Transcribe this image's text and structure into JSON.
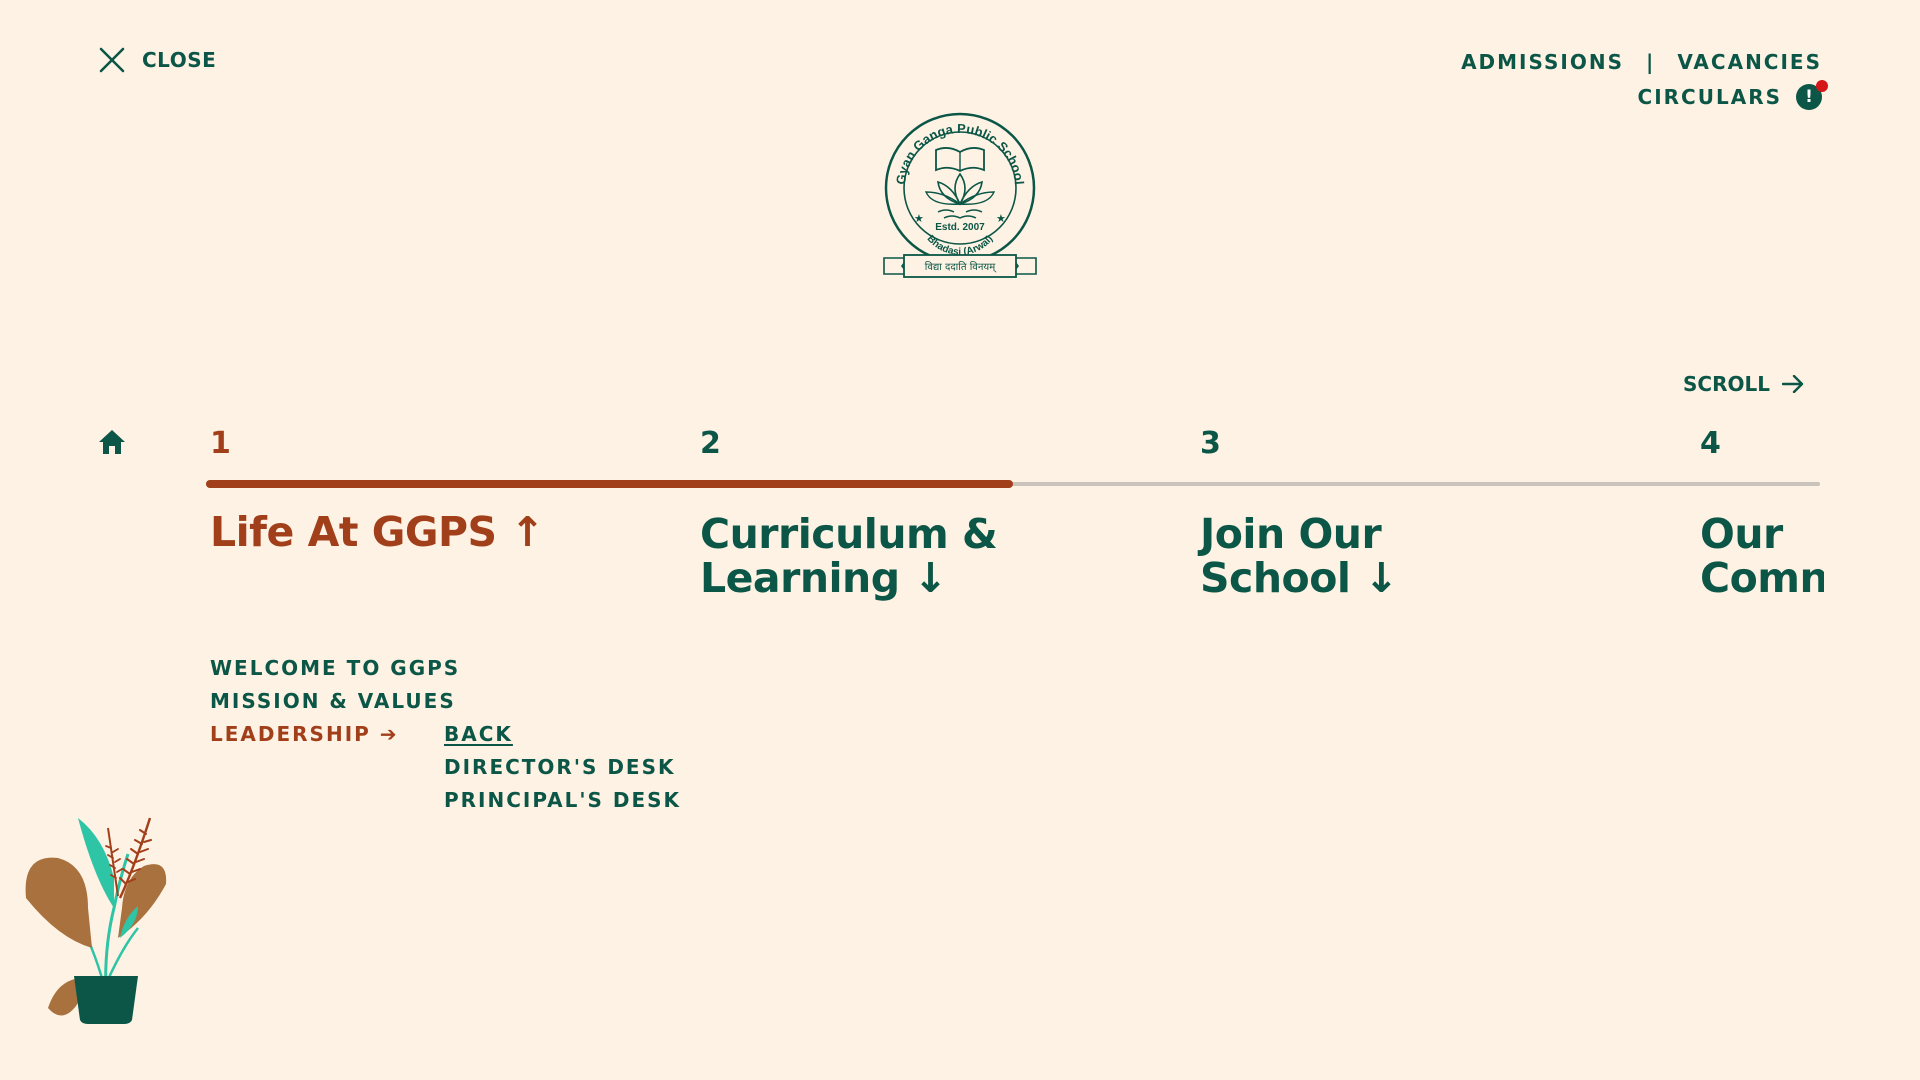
{
  "close": {
    "label": "CLOSE"
  },
  "top_links": {
    "admissions": "ADMISSIONS",
    "separator": "|",
    "vacancies": "VACANCIES",
    "circulars": "CIRCULARS",
    "circulars_alert": "!"
  },
  "logo": {
    "school_name": "Gyan Ganga Public School",
    "established": "Estd. 2007",
    "location": "Bhadasi (Arwal)",
    "motto": "विद्या ददाति विनयम्"
  },
  "scroll": {
    "label": "SCROLL"
  },
  "nav": {
    "progress": 0.5,
    "sections": [
      {
        "number": "1",
        "line1": "Life At GGPS",
        "line2": "",
        "arrow": "↑"
      },
      {
        "number": "2",
        "line1": "Curriculum &",
        "line2": "Learning",
        "arrow": "↓"
      },
      {
        "number": "3",
        "line1": "Join Our",
        "line2": "School",
        "arrow": "↓"
      },
      {
        "number": "4",
        "line1": "Our",
        "line2": "Comn",
        "arrow": ""
      }
    ]
  },
  "submenu": {
    "items": [
      "WELCOME TO GGPS",
      "MISSION & VALUES",
      "LEADERSHIP"
    ],
    "leadership_arrow": "➔",
    "sub_items": [
      "BACK",
      "DIRECTOR'S DESK",
      "PRINCIPAL'S DESK"
    ]
  },
  "colors": {
    "background": "#fdf2e4",
    "primary_green": "#0b5646",
    "accent_rust": "#a13f1a",
    "track_grey": "#c9c3bb",
    "alert_red": "#d41616"
  }
}
